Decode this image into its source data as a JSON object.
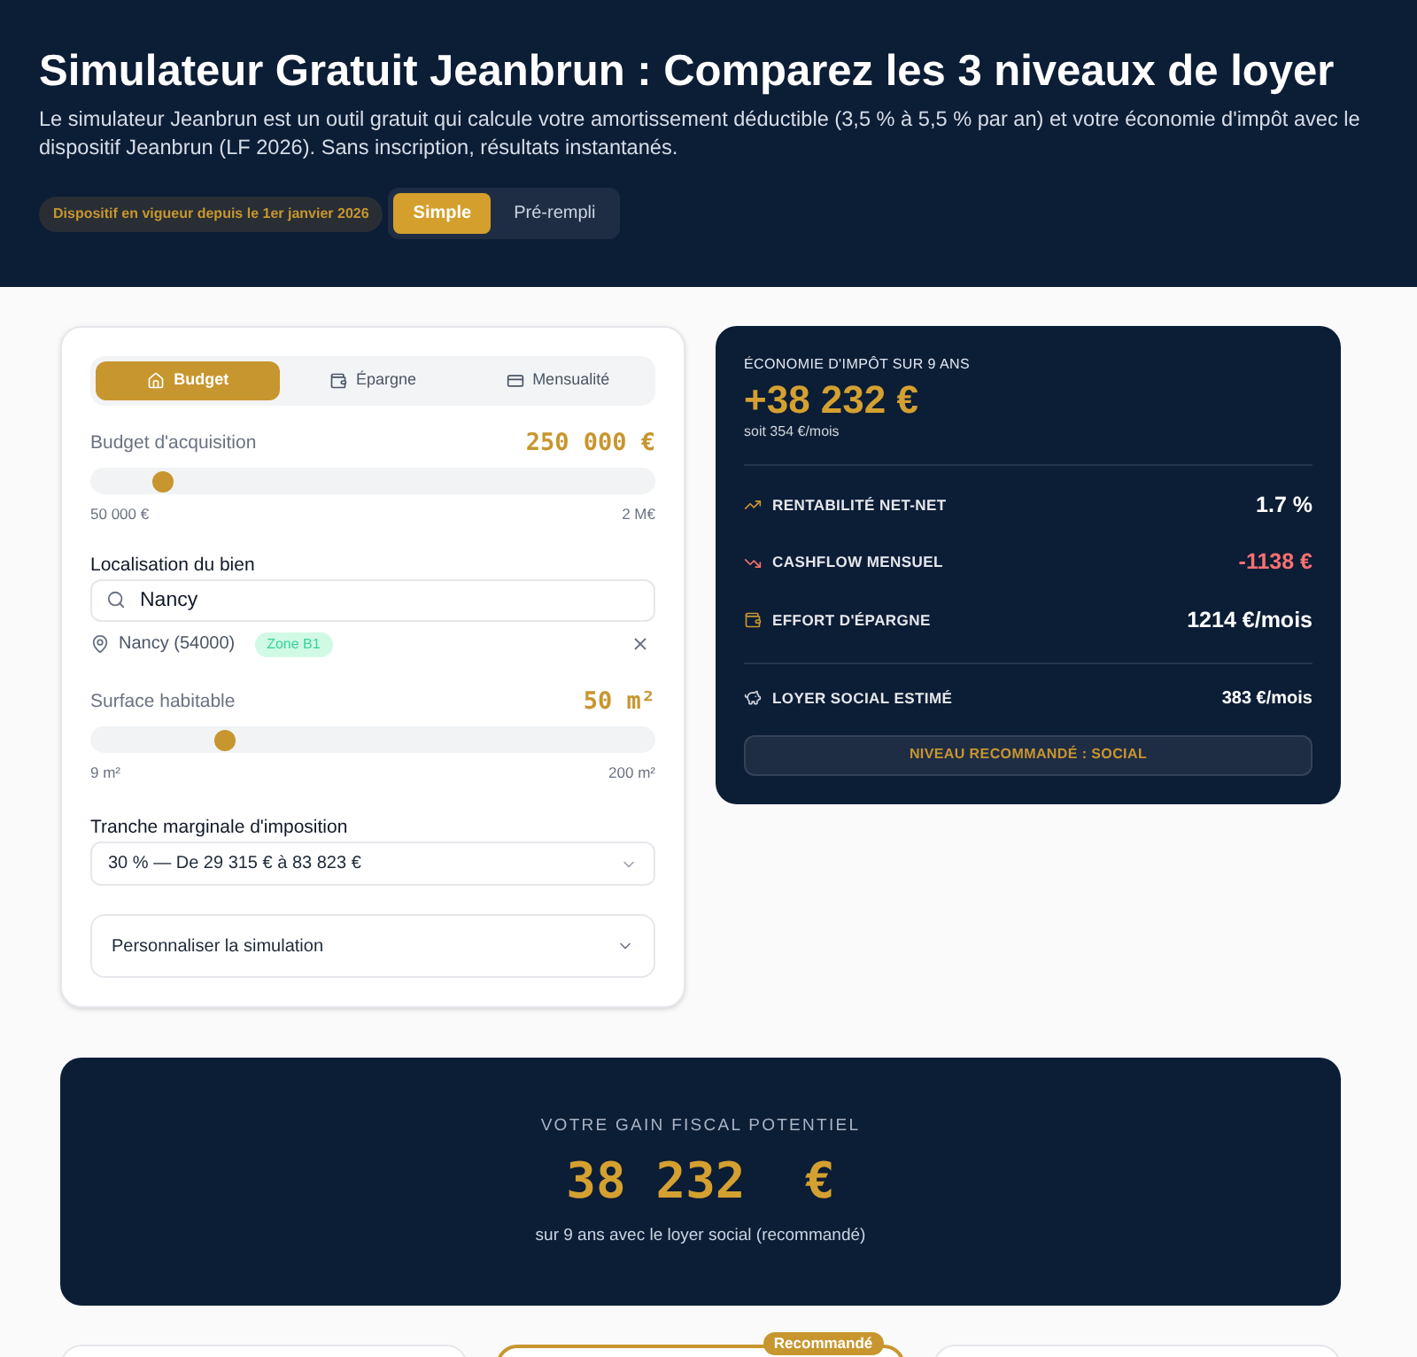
{
  "header": {
    "title": "Simulateur Gratuit Jeanbrun : Comparez les 3 niveaux de loyer",
    "description": "Le simulateur Jeanbrun est un outil gratuit qui calcule votre amortissement déductible (3,5 % à 5,5 % par an) et votre économie d'impôt avec le dispositif Jeanbrun (LF 2026). Sans inscription, résultats instantanés.",
    "badge": "Dispositif en vigueur depuis le 1er janvier 2026",
    "modes": [
      {
        "label": "Simple",
        "selected": true
      },
      {
        "label": "Pré-rempli",
        "selected": false
      }
    ]
  },
  "simulator": {
    "tabs": [
      {
        "label": "Budget",
        "kind": "home",
        "selected": true
      },
      {
        "label": "Épargne",
        "kind": "wallet",
        "selected": false
      },
      {
        "label": "Mensualité",
        "kind": "card",
        "selected": false
      }
    ],
    "budget": {
      "label": "Budget d'acquisition",
      "value": "250 000 €",
      "level": 0.11,
      "min": "50 000 €",
      "max": "2 M€"
    },
    "location": {
      "label": "Localisation du bien",
      "value": "Nancy",
      "result": "Nancy (54000)",
      "zone": "Zone B1"
    },
    "surface": {
      "label": "Surface habitable",
      "value": "50 m²",
      "level": 0.22,
      "min": "9 m²",
      "max": "200 m²"
    },
    "tax_bracket": {
      "label": "Tranche marginale d'imposition",
      "value": "30 % — De 29 315 € à 83 823 €"
    },
    "customize": {
      "label": "Personnaliser la simulation",
      "expanded": false
    }
  },
  "results": {
    "label": "ÉCONOMIE D'IMPÔT SUR 9 ANS",
    "value": "+38 232 €",
    "sub": "soit 354 €/mois",
    "metrics": [
      {
        "kind": "rising",
        "label": "RENTABILITÉ NET-NET",
        "value": "1.7 %",
        "negative": false
      },
      {
        "kind": "falling",
        "label": "CASHFLOW MENSUEL",
        "value": "-1138 €",
        "negative": true
      },
      {
        "kind": "wallet",
        "label": "EFFORT D'ÉPARGNE",
        "value": "1214 €/mois",
        "negative": false
      }
    ],
    "rent": {
      "label": "LOYER SOCIAL ESTIMÉ",
      "value": "383 €/mois"
    },
    "recommendation": "NIVEAU RECOMMANDÉ : SOCIAL"
  },
  "gain": {
    "label": "VOTRE GAIN FISCAL POTENTIEL",
    "value": "38 232  €",
    "note": "sur 9 ans avec le loyer social (recommandé)"
  },
  "level_cards": [
    {
      "recommended": false
    },
    {
      "recommended": true,
      "badge": "Recommandé"
    },
    {
      "recommended": false
    }
  ]
}
